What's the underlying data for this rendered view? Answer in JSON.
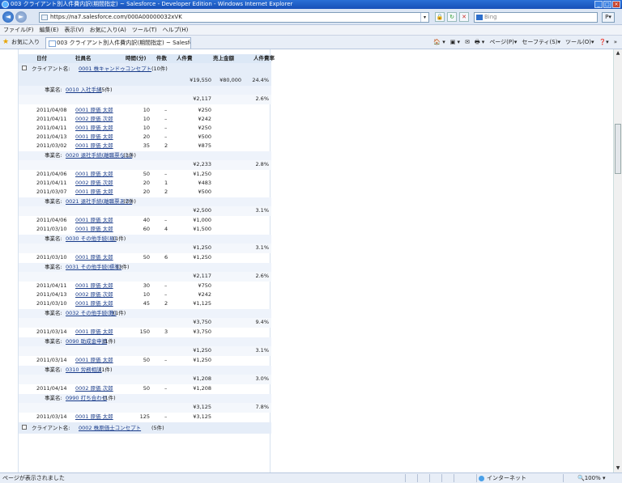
{
  "window": {
    "title": "003 クライアント別人件費内訳(期間指定) ~ Salesforce - Developer Edition - Windows Internet Explorer",
    "buttons": [
      "_",
      "□",
      "×"
    ]
  },
  "nav": {
    "back": "◄",
    "forward": "►",
    "url": "https://na7.salesforce.com/000A00000032xVK",
    "search_placeholder": "Bing",
    "search_btn": "P▾"
  },
  "menu": [
    "ファイル(F)",
    "編集(E)",
    "表示(V)",
    "お気に入り(A)",
    "ツール(T)",
    "ヘルプ(H)"
  ],
  "favbar": {
    "favorites": "お気に入り",
    "tab": "003 クライアント別人件費内訳(期間指定) ~ Salesforce...",
    "tools": [
      "🏠 ▾",
      "▣ ▾",
      "✉",
      "🖶 ▾",
      "ページ(P)▾",
      "セーフティ(S)▾",
      "ツール(O)▾",
      "❓▾",
      "»"
    ]
  },
  "report": {
    "columns": [
      "日付",
      "社員名",
      "時間(分)",
      "件数",
      "人件費",
      "売上金額",
      "人件費率"
    ],
    "groups": [
      {
        "label": "クライアント名: ",
        "link": "0001 株キャンドゥコンセプト",
        "count": "(10件)",
        "total_cost": "¥19,550",
        "total_sales": "¥80,000",
        "total_rate": "24.4%",
        "items": [
          {
            "label": "事業名: ",
            "link": "0010 入社手続",
            "count": "(5件)",
            "cost": "¥2,117",
            "rate": "2.6%",
            "rows": []
          },
          {
            "label": "",
            "link": "",
            "count": "",
            "cost": "",
            "rate": "",
            "rows": [
              {
                "date": "2011/04/08",
                "emp": "0001 原価 太郎",
                "min": "10",
                "cnt": "–",
                "cost": "¥250"
              },
              {
                "date": "2011/04/11",
                "emp": "0002 原価 次郎",
                "min": "10",
                "cnt": "–",
                "cost": "¥242"
              },
              {
                "date": "2011/04/11",
                "emp": "0001 原価 太郎",
                "min": "10",
                "cnt": "–",
                "cost": "¥250"
              },
              {
                "date": "2011/04/13",
                "emp": "0001 原価 太郎",
                "min": "20",
                "cnt": "–",
                "cost": "¥500"
              },
              {
                "date": "2011/03/02",
                "emp": "0001 原価 太郎",
                "min": "35",
                "cnt": "2",
                "cost": "¥875"
              }
            ]
          },
          {
            "label": "事業名: ",
            "link": "0020 退社手続(離職票なし)",
            "count": "(3件)",
            "cost": "¥2,233",
            "rate": "2.8%",
            "rows": [
              {
                "date": "2011/04/06",
                "emp": "0001 原価 太郎",
                "min": "50",
                "cnt": "–",
                "cost": "¥1,250"
              },
              {
                "date": "2011/04/11",
                "emp": "0002 原価 次郎",
                "min": "20",
                "cnt": "1",
                "cost": "¥483"
              },
              {
                "date": "2011/03/07",
                "emp": "0001 原価 太郎",
                "min": "20",
                "cnt": "2",
                "cost": "¥500"
              }
            ]
          },
          {
            "label": "事業名: ",
            "link": "0021 退社手続(離職票あり)",
            "count": "(2件)",
            "cost": "¥2,500",
            "rate": "3.1%",
            "rows": [
              {
                "date": "2011/04/06",
                "emp": "0001 原価 太郎",
                "min": "40",
                "cnt": "–",
                "cost": "¥1,000"
              },
              {
                "date": "2011/03/10",
                "emp": "0001 原価 太郎",
                "min": "60",
                "cnt": "4",
                "cost": "¥1,500"
              }
            ]
          },
          {
            "label": "事業名: ",
            "link": "0030 その他手続(易)",
            "count": "(1件)",
            "cost": "¥1,250",
            "rate": "3.1%",
            "rows": [
              {
                "date": "2011/03/10",
                "emp": "0001 原価 太郎",
                "min": "50",
                "cnt": "6",
                "cost": "¥1,250"
              }
            ]
          },
          {
            "label": "事業名: ",
            "link": "0031 その他手続(標準)",
            "count": "(3件)",
            "cost": "¥2,117",
            "rate": "2.6%",
            "rows": [
              {
                "date": "2011/04/11",
                "emp": "0001 原価 太郎",
                "min": "30",
                "cnt": "–",
                "cost": "¥750"
              },
              {
                "date": "2011/04/13",
                "emp": "0002 原価 次郎",
                "min": "10",
                "cnt": "–",
                "cost": "¥242"
              },
              {
                "date": "2011/03/10",
                "emp": "0001 原価 太郎",
                "min": "45",
                "cnt": "2",
                "cost": "¥1,125"
              }
            ]
          },
          {
            "label": "事業名: ",
            "link": "0032 その他手続(難)",
            "count": "(1件)",
            "cost": "¥3,750",
            "rate": "9.4%",
            "rows": [
              {
                "date": "2011/03/14",
                "emp": "0001 原価 太郎",
                "min": "150",
                "cnt": "3",
                "cost": "¥3,750"
              }
            ]
          },
          {
            "label": "事業名: ",
            "link": "0090 助成金申請",
            "count": "(1件)",
            "cost": "¥1,250",
            "rate": "3.1%",
            "rows": [
              {
                "date": "2011/03/14",
                "emp": "0001 原価 太郎",
                "min": "50",
                "cnt": "–",
                "cost": "¥1,250"
              }
            ]
          },
          {
            "label": "事業名: ",
            "link": "0310 労務相談",
            "count": "(1件)",
            "cost": "¥1,208",
            "rate": "3.0%",
            "rows": [
              {
                "date": "2011/04/14",
                "emp": "0002 原価 次郎",
                "min": "50",
                "cnt": "–",
                "cost": "¥1,208"
              }
            ]
          },
          {
            "label": "事業名: ",
            "link": "0990 打ち合わせ",
            "count": "(1件)",
            "cost": "¥3,125",
            "rate": "7.8%",
            "rows": [
              {
                "date": "2011/03/14",
                "emp": "0001 原価 太郎",
                "min": "125",
                "cnt": "–",
                "cost": "¥3,125"
              }
            ]
          }
        ]
      },
      {
        "label": "クライアント名: ",
        "link": "0002 株原価士コンセプト",
        "count": "(5件)"
      }
    ]
  },
  "status": {
    "message": "ページが表示されました",
    "zone": "インターネット",
    "zoom": "🔍100% ▾"
  }
}
